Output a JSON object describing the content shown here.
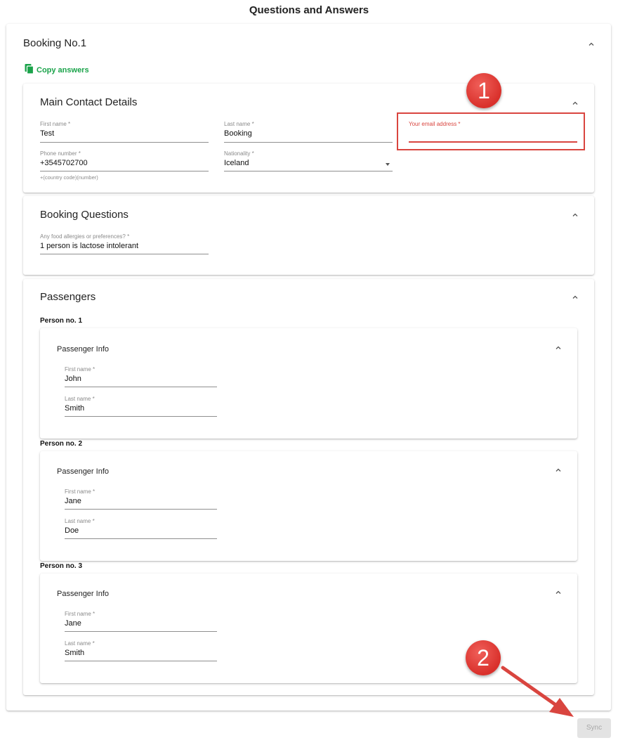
{
  "page": {
    "title": "Questions and Answers"
  },
  "booking": {
    "title": "Booking No.1",
    "copy_label": "Copy answers"
  },
  "contact": {
    "title": "Main Contact Details",
    "first_name_label": "First name *",
    "first_name_value": "Test",
    "last_name_label": "Last name *",
    "last_name_value": "Booking",
    "email_label": "Your email address *",
    "email_value": "",
    "phone_label": "Phone number *",
    "phone_value": "+3545702700",
    "phone_hint": "+(country code)(number)",
    "nationality_label": "Nationality *",
    "nationality_value": "Iceland"
  },
  "questions": {
    "title": "Booking Questions",
    "food_label": "Any food allergies or preferences? *",
    "food_value": "1 person is lactose intolerant"
  },
  "passengers": {
    "title": "Passengers",
    "people": [
      {
        "label": "Person no. 1",
        "info_title": "Passenger Info",
        "first_label": "First name *",
        "first_value": "John",
        "last_label": "Last name *",
        "last_value": "Smith"
      },
      {
        "label": "Person no. 2",
        "info_title": "Passenger Info",
        "first_label": "First name *",
        "first_value": "Jane",
        "last_label": "Last name *",
        "last_value": "Doe"
      },
      {
        "label": "Person no. 3",
        "info_title": "Passenger Info",
        "first_label": "First name *",
        "first_value": "Jane",
        "last_label": "Last name *",
        "last_value": "Smith"
      }
    ]
  },
  "annotations": {
    "marker1": "1",
    "marker2": "2"
  },
  "actions": {
    "sync_label": "Sync"
  },
  "colors": {
    "accent_green": "#1aa34a",
    "error_red": "#d9453f",
    "marker_red": "#d9302b"
  }
}
